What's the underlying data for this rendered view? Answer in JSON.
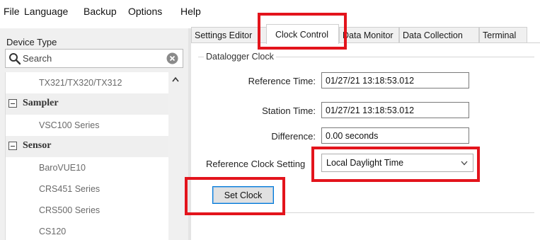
{
  "menu": {
    "file": "File",
    "language": "Language",
    "backup": "Backup",
    "options": "Options",
    "help": "Help"
  },
  "left": {
    "device_type_label": "Device Type",
    "search_placeholder": "Search",
    "tree": {
      "item_tx": "TX321/TX320/TX312",
      "cat_sampler": "Sampler",
      "item_vsc": "VSC100 Series",
      "cat_sensor": "Sensor",
      "item_barovue": "BaroVUE10",
      "item_crs451": "CRS451 Series",
      "item_crs500": "CRS500 Series",
      "item_cs120": "CS120"
    }
  },
  "tabs": {
    "settings_editor": "Settings Editor",
    "clock_control": "Clock Control",
    "data_monitor": "Data Monitor",
    "data_collection": "Data Collection",
    "terminal": "Terminal",
    "active": "Clock Control"
  },
  "clock": {
    "group_title": "Datalogger Clock",
    "reference_time_label": "Reference Time:",
    "reference_time_value": "01/27/21 13:18:53.012",
    "station_time_label": "Station Time:",
    "station_time_value": "01/27/21 13:18:53.012",
    "difference_label": "Difference:",
    "difference_value": "0.00 seconds",
    "reference_clock_setting_label": "Reference Clock Setting",
    "reference_clock_setting_value": "Local Daylight Time",
    "set_clock_button": "Set Clock"
  },
  "colors": {
    "highlight": "#e3141c",
    "button_focus": "#0078d7"
  }
}
